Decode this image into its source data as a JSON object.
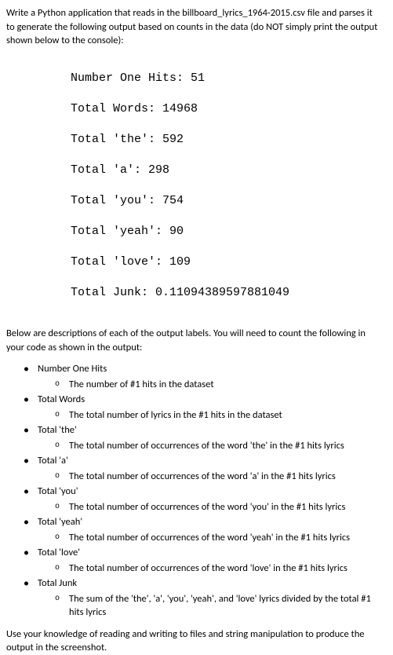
{
  "intro": "Write a Python application that reads in the billboard_lyrics_1964-2015.csv file and parses it to generate the following output based on counts in the data (do NOT simply print the output shown below to the console):",
  "output": {
    "line1": "Number One Hits: 51",
    "line2": "Total Words: 14968",
    "line3": "Total 'the': 592",
    "line4": "Total 'a': 298",
    "line5": "Total 'you': 754",
    "line6": "Total 'yeah': 90",
    "line7": "Total 'love': 109",
    "line8": "Total Junk: 0.11094389597881049"
  },
  "mid": "Below are descriptions of each of the output labels. You will need to count the following in your code as shown in the output:",
  "bullets": {
    "b1": {
      "label": "Number One Hits",
      "desc": "The number of #1 hits in the dataset"
    },
    "b2": {
      "label": "Total Words",
      "desc": "The total number of lyrics in the #1 hits in the dataset"
    },
    "b3": {
      "label": "Total 'the'",
      "desc": "The total number of occurrences of the word 'the' in the #1 hits lyrics"
    },
    "b4": {
      "label": "Total 'a'",
      "desc": "The total number of occurrences of the word 'a' in the #1 hits lyrics"
    },
    "b5": {
      "label": "Total 'you'",
      "desc": "The total number of occurrences of the word 'you' in the #1 hits lyrics"
    },
    "b6": {
      "label": "Total 'yeah'",
      "desc": "The total number of occurrences of the word 'yeah' in the #1 hits lyrics"
    },
    "b7": {
      "label": "Total 'love'",
      "desc": "The total number of occurrences of the word 'love' in the #1 hits lyrics"
    },
    "b8": {
      "label": "Total Junk",
      "desc": "The sum of the 'the', 'a', 'you', 'yeah', and 'love' lyrics divided by the total #1 hits lyrics"
    }
  },
  "closing": "Use your knowledge of reading and writing to files and string manipulation to produce the output in the screenshot."
}
